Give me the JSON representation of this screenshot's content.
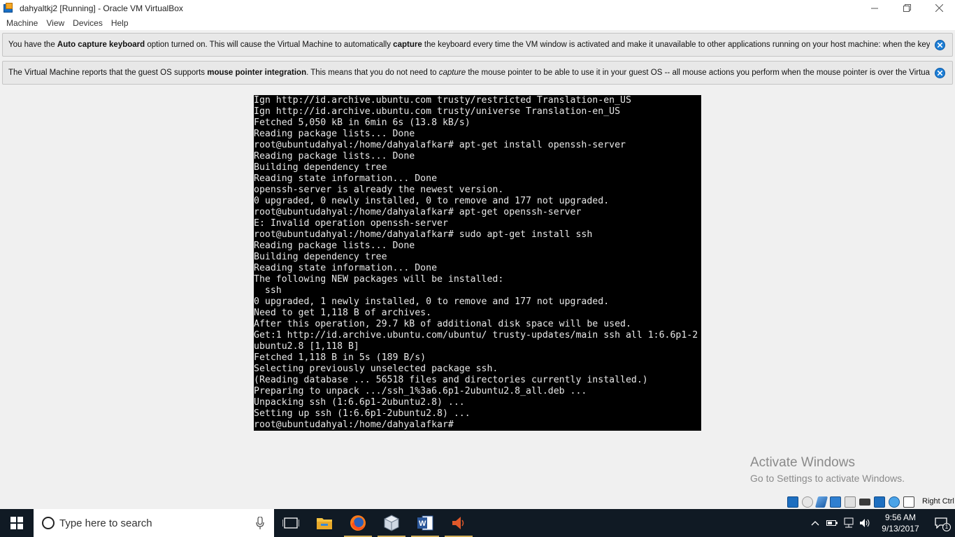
{
  "window": {
    "title": "dahyaltkj2 [Running] - Oracle VM VirtualBox"
  },
  "menu": {
    "items": [
      "Machine",
      "View",
      "Devices",
      "Help"
    ]
  },
  "banners": {
    "keyboard": {
      "t1": "You have the ",
      "b1": "Auto capture keyboard",
      "t2": " option turned on. This will cause the Virtual Machine to automatically ",
      "b2": "capture",
      "t3": " the keyboard every time the VM window is activated and make it unavailable to other applications running on your host machine: when the keyboard is"
    },
    "mouse": {
      "t1": "The Virtual Machine reports that the guest OS supports ",
      "b1": "mouse pointer integration",
      "t2": ". This means that you do not need to ",
      "i1": "capture",
      "t3": " the mouse pointer to be able to use it in your guest OS -- all mouse actions you perform when the mouse pointer is over the Virtual Machine's"
    }
  },
  "terminal": {
    "lines": [
      "Ign http://id.archive.ubuntu.com trusty/restricted Translation-en_US",
      "Ign http://id.archive.ubuntu.com trusty/universe Translation-en_US",
      "Fetched 5,050 kB in 6min 6s (13.8 kB/s)",
      "Reading package lists... Done",
      "root@ubuntudahyal:/home/dahyalafkar# apt-get install openssh-server",
      "Reading package lists... Done",
      "Building dependency tree",
      "Reading state information... Done",
      "openssh-server is already the newest version.",
      "0 upgraded, 0 newly installed, 0 to remove and 177 not upgraded.",
      "root@ubuntudahyal:/home/dahyalafkar# apt-get openssh-server",
      "E: Invalid operation openssh-server",
      "root@ubuntudahyal:/home/dahyalafkar# sudo apt-get install ssh",
      "Reading package lists... Done",
      "Building dependency tree",
      "Reading state information... Done",
      "The following NEW packages will be installed:",
      "  ssh",
      "0 upgraded, 1 newly installed, 0 to remove and 177 not upgraded.",
      "Need to get 1,118 B of archives.",
      "After this operation, 29.7 kB of additional disk space will be used.",
      "Get:1 http://id.archive.ubuntu.com/ubuntu/ trusty-updates/main ssh all 1:6.6p1-2",
      "ubuntu2.8 [1,118 B]",
      "Fetched 1,118 B in 5s (189 B/s)",
      "Selecting previously unselected package ssh.",
      "(Reading database ... 56518 files and directories currently installed.)",
      "Preparing to unpack .../ssh_1%3a6.6p1-2ubuntu2.8_all.deb ...",
      "Unpacking ssh (1:6.6p1-2ubuntu2.8) ...",
      "Setting up ssh (1:6.6p1-2ubuntu2.8) ...",
      "root@ubuntudahyal:/home/dahyalafkar#"
    ]
  },
  "watermark": {
    "title": "Activate Windows",
    "subtitle": "Go to Settings to activate Windows."
  },
  "statusbar": {
    "host_key": "Right Ctrl",
    "icons": [
      "hard-disk-icon",
      "optical-drive-icon",
      "audio-icon",
      "network-icon",
      "usb-icon",
      "shared-folders-icon",
      "display-icon",
      "video-capture-icon",
      "mouse-integration-icon",
      "keyboard-capture-icon"
    ]
  },
  "taskbar": {
    "search_placeholder": "Type here to search",
    "apps": [
      "task-view-icon",
      "file-explorer-icon",
      "firefox-icon",
      "virtualbox-icon",
      "word-icon",
      "speaker-app-icon"
    ],
    "clock_time": "9:56 AM",
    "clock_date": "9/13/2017",
    "notification_count": "1"
  },
  "colors": {
    "taskbar_bg": "#101a24",
    "terminal_bg": "#000000",
    "terminal_fg": "#e8e8e8",
    "banner_bg": "#e8e8e8",
    "accent": "#1e7fd6"
  }
}
